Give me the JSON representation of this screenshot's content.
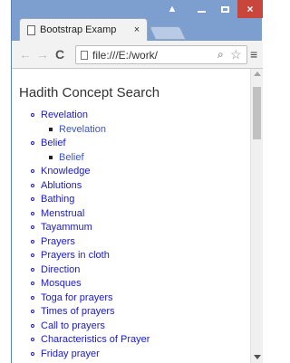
{
  "browser": {
    "tab_title": "Bootstrap Examp",
    "tab_close": "×",
    "url": "file:///E:/work/",
    "window_controls": {
      "user": "▲",
      "minimize": "—",
      "maximize": "□",
      "close": "×"
    },
    "nav": {
      "back": "←",
      "forward": "→",
      "reload": "C",
      "zoom": "🔍",
      "star": "☆",
      "menu": "≡"
    }
  },
  "page": {
    "title": "Hadith Concept Search",
    "concepts": [
      {
        "label": "Revelation",
        "children": [
          "Revelation"
        ]
      },
      {
        "label": "Belief",
        "children": [
          "Belief"
        ]
      },
      {
        "label": "Knowledge",
        "children": []
      },
      {
        "label": "Ablutions",
        "children": []
      },
      {
        "label": "Bathing",
        "children": []
      },
      {
        "label": "Menstrual",
        "children": []
      },
      {
        "label": "Tayammum",
        "children": []
      },
      {
        "label": "Prayers",
        "children": []
      },
      {
        "label": "Prayers in cloth",
        "children": []
      },
      {
        "label": "Direction",
        "children": []
      },
      {
        "label": "Mosques",
        "children": []
      },
      {
        "label": "Toga for prayers",
        "children": []
      },
      {
        "label": "Times of prayers",
        "children": []
      },
      {
        "label": "Call to prayers",
        "children": []
      },
      {
        "label": "Characteristics of Prayer",
        "children": []
      },
      {
        "label": "Friday prayer",
        "children": []
      }
    ]
  }
}
